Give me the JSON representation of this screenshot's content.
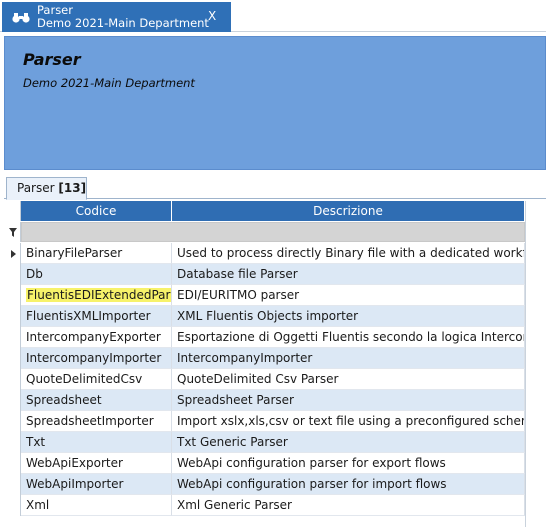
{
  "doc_tab": {
    "title": "Parser",
    "subtitle": "Demo 2021-Main Department",
    "close_label": "X",
    "icon": "binoculars-icon"
  },
  "header": {
    "title": "Parser",
    "subtitle": "Demo 2021-Main Department",
    "background_color": "#6e9fdc"
  },
  "grid_tab": {
    "label": "Parser",
    "count": "[13]"
  },
  "grid": {
    "header_color": "#2f6db3",
    "columns": [
      "Codice",
      "Descrizione"
    ],
    "filter_icon": "filter-icon",
    "rows": [
      {
        "codice": "BinaryFileParser",
        "descrizione": "Used to process directly Binary file with a dedicated workflow",
        "current": true
      },
      {
        "codice": "Db",
        "descrizione": "Database file Parser"
      },
      {
        "codice": "FluentisEDIExtendedParser",
        "descrizione": "EDI/EURITMO parser",
        "highlighted": true
      },
      {
        "codice": "FluentisXMLImporter",
        "descrizione": "XML Fluentis Objects importer"
      },
      {
        "codice": "IntercompanyExporter",
        "descrizione": "Esportazione di Oggetti Fluentis secondo la logica Intercompany"
      },
      {
        "codice": "IntercompanyImporter",
        "descrizione": "IntercompanyImporter"
      },
      {
        "codice": "QuoteDelimitedCsv",
        "descrizione": "QuoteDelimited Csv Parser"
      },
      {
        "codice": "Spreadsheet",
        "descrizione": "Spreadsheet Parser"
      },
      {
        "codice": "SpreadsheetImporter",
        "descrizione": "Import xslx,xls,csv or text file using a preconfigured schema"
      },
      {
        "codice": "Txt",
        "descrizione": "Txt Generic Parser"
      },
      {
        "codice": "WebApiExporter",
        "descrizione": "WebApi configuration parser for export flows"
      },
      {
        "codice": "WebApiImporter",
        "descrizione": "WebApi configuration parser for import flows"
      },
      {
        "codice": "Xml",
        "descrizione": "Xml Generic Parser"
      }
    ]
  }
}
